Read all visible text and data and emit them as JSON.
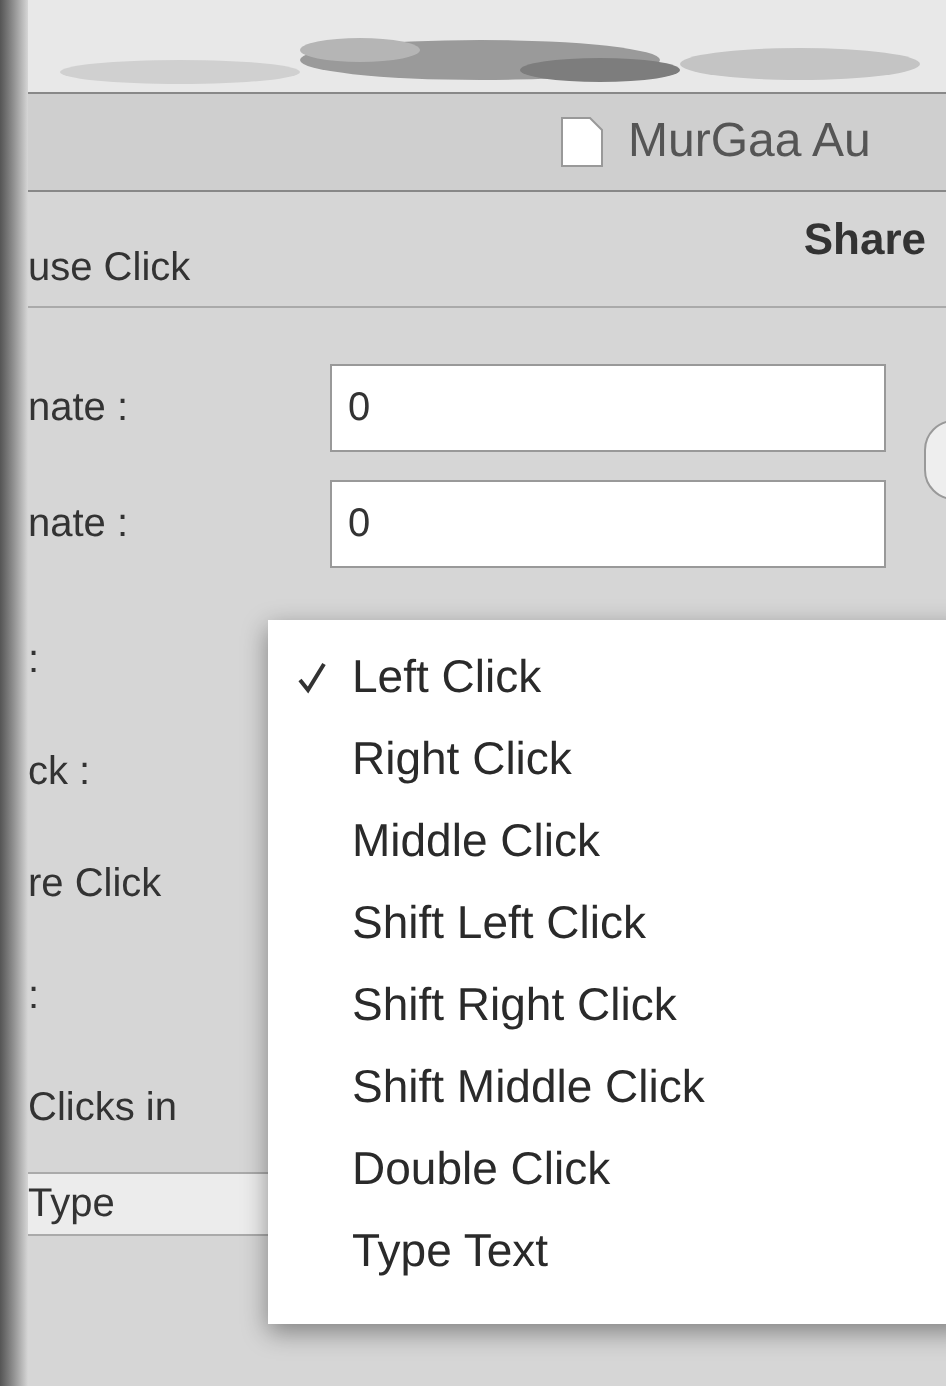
{
  "window": {
    "title": "MurGaa Au"
  },
  "section": {
    "title": "use Click",
    "side_title": "Share"
  },
  "fields": [
    {
      "label": "nate :",
      "value": "0"
    },
    {
      "label": "nate :",
      "value": "0"
    }
  ],
  "labels": [
    ":",
    "ck :",
    "re Click",
    ":",
    "Clicks in"
  ],
  "table_header": "Type",
  "menu": [
    {
      "label": "Left Click",
      "selected": true
    },
    {
      "label": "Right Click",
      "selected": false
    },
    {
      "label": "Middle Click",
      "selected": false
    },
    {
      "label": "Shift Left Click",
      "selected": false
    },
    {
      "label": "Shift Right Click",
      "selected": false
    },
    {
      "label": "Shift Middle Click",
      "selected": false
    },
    {
      "label": "Double Click",
      "selected": false
    },
    {
      "label": "Type Text",
      "selected": false
    }
  ]
}
